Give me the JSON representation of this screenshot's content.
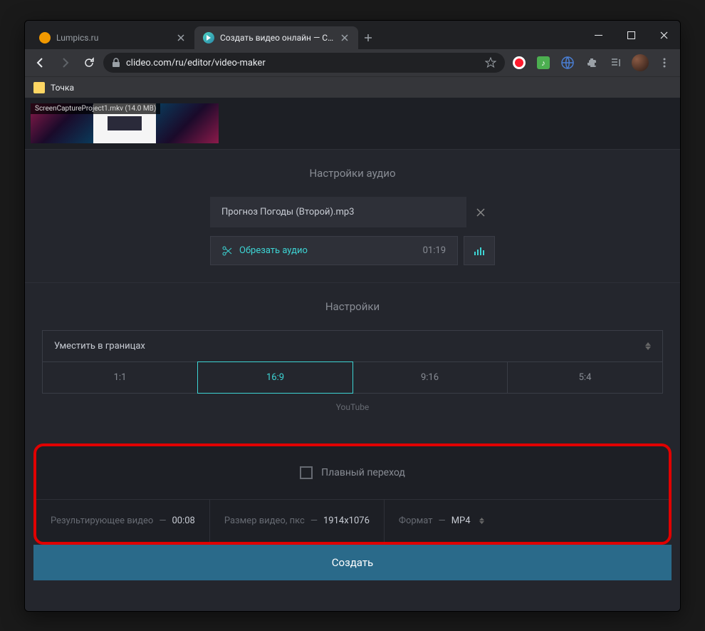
{
  "browser": {
    "tabs": [
      {
        "title": "Lumpics.ru",
        "favicon_color": "#f29900"
      },
      {
        "title": "Создать видео онлайн — Сдела",
        "favicon_color": "#4dd4c4"
      }
    ],
    "url": "clideo.com/ru/editor/video-maker",
    "bookmark": "Точка"
  },
  "timeline": {
    "clip_label": "ScreenCaptureProject1.mkv (14.0 MB)"
  },
  "audio": {
    "section_title": "Настройки аудио",
    "file_name": "Прогноз Погоды (Второй).mp3",
    "trim_label": "Обрезать аудио",
    "duration": "01:19"
  },
  "settings": {
    "section_title": "Настройки",
    "fit_mode": "Уместить в границах",
    "ratios": [
      "1:1",
      "16:9",
      "9:16",
      "5:4"
    ],
    "ratio_sub": "YouTube"
  },
  "output": {
    "crossfade_label": "Плавный переход",
    "result_label": "Результирующее видео",
    "result_value": "00:08",
    "size_label": "Размер видео, пкс",
    "size_value": "1914x1076",
    "format_label": "Формат",
    "format_value": "MP4"
  },
  "actions": {
    "create": "Создать"
  }
}
